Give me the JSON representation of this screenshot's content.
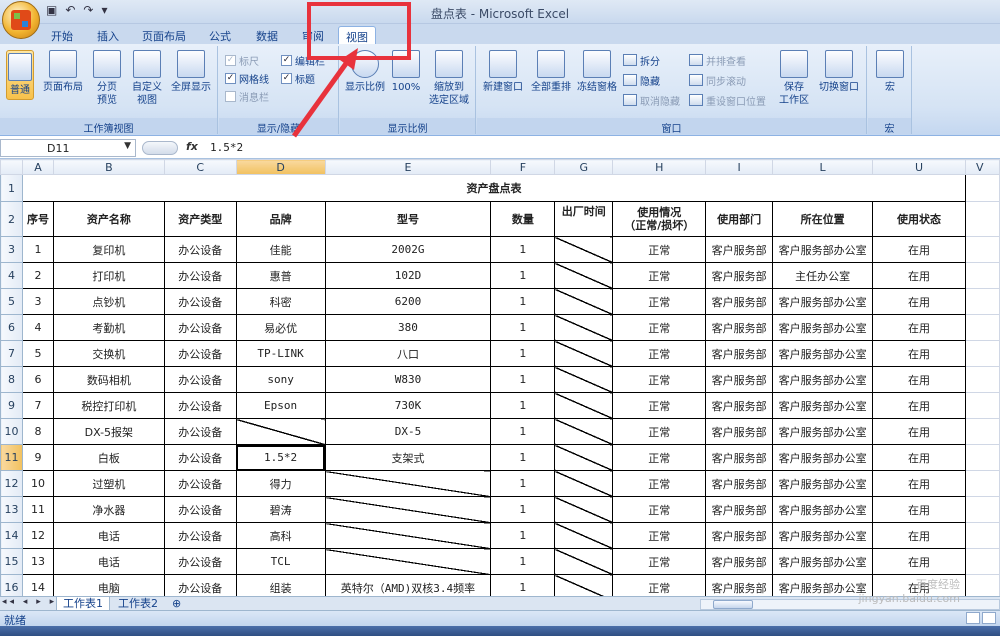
{
  "window": {
    "title": "盘点表 - Microsoft Excel"
  },
  "tabs": [
    {
      "label": "开始"
    },
    {
      "label": "插入"
    },
    {
      "label": "页面布局"
    },
    {
      "label": "公式"
    },
    {
      "label": "数据"
    },
    {
      "label": "审阅"
    },
    {
      "label": "视图"
    }
  ],
  "ribbon": {
    "workbook_views": {
      "label": "工作簿视图",
      "normal": "普通",
      "page_layout": "页面布局",
      "page_break_1": "分页",
      "page_break_2": "预览",
      "custom_1": "自定义",
      "custom_2": "视图",
      "fullscreen": "全屏显示"
    },
    "show_hide": {
      "label": "显示/隐藏",
      "ruler": "标尺",
      "gridlines": "网格线",
      "message_bar": "消息栏",
      "formula_bar": "编辑栏",
      "headings": "标题"
    },
    "zoom": {
      "label": "显示比例",
      "zoom": "显示比例",
      "hundred": "100%",
      "to_selection_1": "缩放到",
      "to_selection_2": "选定区域"
    },
    "window": {
      "label": "窗口",
      "new_window": "新建窗口",
      "arrange_all": "全部重排",
      "freeze_panes": "冻结窗格",
      "split": "拆分",
      "hide": "隐藏",
      "unhide": "取消隐藏",
      "side_by_side": "并排查看",
      "sync_scroll": "同步滚动",
      "reset_pos": "重设窗口位置",
      "save_workspace_1": "保存",
      "save_workspace_2": "工作区",
      "switch_windows": "切换窗口"
    },
    "macros": {
      "label": "宏",
      "macros": "宏"
    }
  },
  "formula_bar": {
    "name_box": "D11",
    "fx": "fx",
    "value": "1.5*2"
  },
  "columns": [
    "A",
    "B",
    "C",
    "D",
    "E",
    "F",
    "G",
    "H",
    "I",
    "L",
    "U",
    "V"
  ],
  "rows": [
    "1",
    "2",
    "3",
    "4",
    "5",
    "6",
    "7",
    "8",
    "9",
    "10",
    "11",
    "12",
    "13",
    "14",
    "15",
    "16"
  ],
  "sheet": {
    "title": "资产盘点表",
    "headers": {
      "seq": "序号",
      "name": "资产名称",
      "type": "资产类型",
      "brand": "品牌",
      "model": "型号",
      "qty": "数量",
      "date": "出厂时间",
      "status1": "使用情况",
      "status2": "（正常/损坏）",
      "dept": "使用部门",
      "location": "所在位置",
      "use": "使用状态"
    },
    "records": [
      [
        "1",
        "复印机",
        "办公设备",
        "佳能",
        "2002G",
        "1",
        "正常",
        "客户服务部",
        "客户服务部办公室",
        "在用"
      ],
      [
        "2",
        "打印机",
        "办公设备",
        "惠普",
        "102D",
        "1",
        "正常",
        "客户服务部",
        "主任办公室",
        "在用"
      ],
      [
        "3",
        "点钞机",
        "办公设备",
        "科密",
        "6200",
        "1",
        "正常",
        "客户服务部",
        "客户服务部办公室",
        "在用"
      ],
      [
        "4",
        "考勤机",
        "办公设备",
        "易必优",
        "380",
        "1",
        "正常",
        "客户服务部",
        "客户服务部办公室",
        "在用"
      ],
      [
        "5",
        "交换机",
        "办公设备",
        "TP-LINK",
        "八口",
        "1",
        "正常",
        "客户服务部",
        "客户服务部办公室",
        "在用"
      ],
      [
        "6",
        "数码相机",
        "办公设备",
        "sony",
        "W830",
        "1",
        "正常",
        "客户服务部",
        "客户服务部办公室",
        "在用"
      ],
      [
        "7",
        "税控打印机",
        "办公设备",
        "Epson",
        "730K",
        "1",
        "正常",
        "客户服务部",
        "客户服务部办公室",
        "在用"
      ],
      [
        "8",
        "DX-5报架",
        "办公设备",
        "",
        "DX-5",
        "1",
        "正常",
        "客户服务部",
        "客户服务部办公室",
        "在用"
      ],
      [
        "9",
        "白板",
        "办公设备",
        "1.5*2",
        "支架式",
        "1",
        "正常",
        "客户服务部",
        "客户服务部办公室",
        "在用"
      ],
      [
        "10",
        "过塑机",
        "办公设备",
        "得力",
        "",
        "1",
        "正常",
        "客户服务部",
        "客户服务部办公室",
        "在用"
      ],
      [
        "11",
        "净水器",
        "办公设备",
        "碧涛",
        "",
        "1",
        "正常",
        "客户服务部",
        "客户服务部办公室",
        "在用"
      ],
      [
        "12",
        "电话",
        "办公设备",
        "高科",
        "",
        "1",
        "正常",
        "客户服务部",
        "客户服务部办公室",
        "在用"
      ],
      [
        "13",
        "电话",
        "办公设备",
        "TCL",
        "",
        "1",
        "正常",
        "客户服务部",
        "客户服务部办公室",
        "在用"
      ],
      [
        "14",
        "电脑",
        "办公设备",
        "组装",
        "英特尔（AMD)双核3.4频率",
        "1",
        "正常",
        "客户服务部",
        "客户服务部办公室",
        "在用"
      ]
    ]
  },
  "sheet_tabs": [
    {
      "label": "工作表1"
    },
    {
      "label": "工作表2"
    }
  ],
  "status": {
    "text": "就绪"
  },
  "watermark": {
    "line1": "百度经验",
    "line2": "jingyan.baidu.com"
  }
}
